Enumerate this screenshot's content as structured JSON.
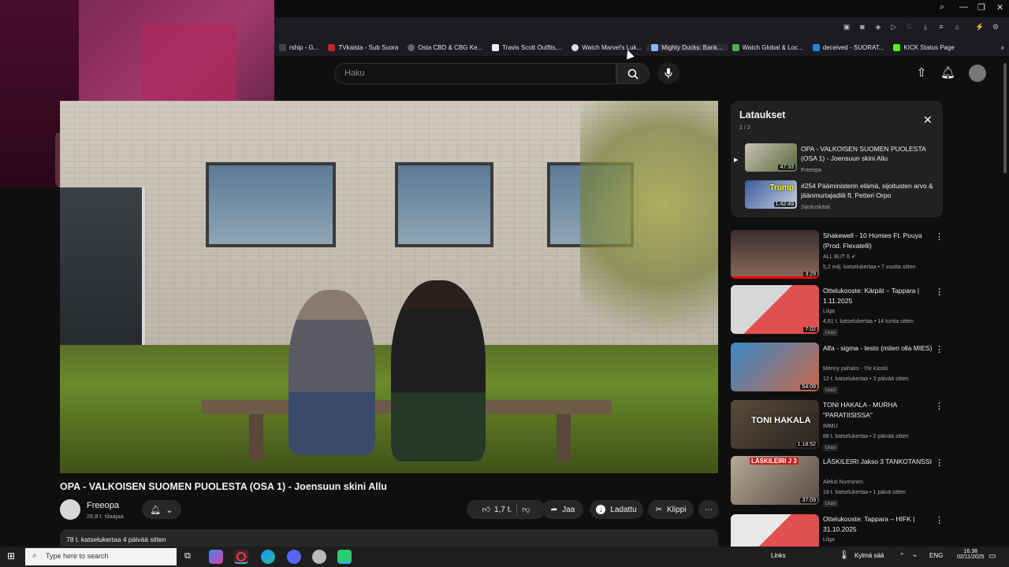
{
  "bookmarks": [
    {
      "label": "rship - G...",
      "color": "#444"
    },
    {
      "label": "TVkaista - Sub Suora",
      "color": "#c0282d"
    },
    {
      "label": "Osta CBD & CBG Ke...",
      "color": "#666"
    },
    {
      "label": "Travis Scott Outfits,...",
      "color": "#eee"
    },
    {
      "label": "Watch Marvel's Luk...",
      "color": "#ddd"
    },
    {
      "label": "Mighty Ducks: Bank...",
      "color": "#8ab4f8"
    },
    {
      "label": "Watch Global & Loc...",
      "color": "#4caf50"
    },
    {
      "label": "deceived - SUORAT...",
      "color": "#1e88e5"
    },
    {
      "label": "KICK Status Page",
      "color": "#53fc18"
    }
  ],
  "header": {
    "search_placeholder": "Haku"
  },
  "video": {
    "title": "OPA - VALKOISEN SUOMEN PUOLESTA (OSA 1) - Joensuun skini Allu",
    "channel": "Freeopa",
    "subscribers": "26,8 t. tilaajaa",
    "likes": "1,7 t.",
    "share_label": "Jaa",
    "download_label": "Ladattu",
    "clip_label": "Klippi",
    "description": "78 t. katselukertaa  4 päivää sitten"
  },
  "downloads": {
    "title": "Lataukset",
    "count": "1 / 2",
    "items": [
      {
        "title": "OPA - VALKOISEN SUOMEN PUOLESTA (OSA 1) - Joensuun skini Allu",
        "channel": "Freeopa",
        "duration": "47:33"
      },
      {
        "title": "#254 Pääministerin elämä, sijoitusten arvo & jäänmurtajadiili ft. Petteri Orpo",
        "channel": "Sijoituskästi",
        "duration": "1:42:49"
      }
    ]
  },
  "recommendations": [
    {
      "title": "Shakewell - 10 Homies Ft. Pouya (Prod. Flexatelli)",
      "channel": "ALL BUT 6",
      "meta": "5,2 milj. katselukertaa • 7 vuotta sitten",
      "duration": "3:29",
      "badge": ""
    },
    {
      "title": "Ottelukooste: Kärpät – Tappara | 1.11.2025",
      "channel": "Liiga",
      "meta": "4,61 t. katselukertaa • 14 tuntia sitten",
      "duration": "7:02",
      "badge": "Uusi"
    },
    {
      "title": "Alfa - sigma - testo (miten olla MIES)",
      "channel": "Menny pahaks - Yle Kioski",
      "meta": "12 t. katselukertaa • 3 päivää sitten",
      "duration": "54:09",
      "badge": "Uusi"
    },
    {
      "title": "TONI HAKALA - MURHA \"PARATIISISSA\"",
      "channel": "IMMU",
      "meta": "88 t. katselukertaa • 2 päivää sitten",
      "duration": "1:18:52",
      "badge": "Uusi"
    },
    {
      "title": "LÄSKILEIRI Jakso 3 TANKOTANSSI",
      "channel": "Aleksi Nurminen",
      "meta": "18 t. katselukertaa • 1 päivä sitten",
      "duration": "37:09",
      "badge": "Uusi"
    },
    {
      "title": "Ottelukooste: Tappara – HIFK | 31.10.2025",
      "channel": "Liiga",
      "meta": "",
      "duration": "",
      "badge": ""
    }
  ],
  "thumb_text": {
    "toni": "TONI HAKALA",
    "laski": "LÄSKILEIRI J 3",
    "trump": "Trump"
  },
  "taskbar": {
    "search_placeholder": "Type here to search",
    "links": "Links",
    "weather": "Kylmä sää",
    "lang": "ENG",
    "time": "16.38",
    "date": "02/11/2025"
  }
}
